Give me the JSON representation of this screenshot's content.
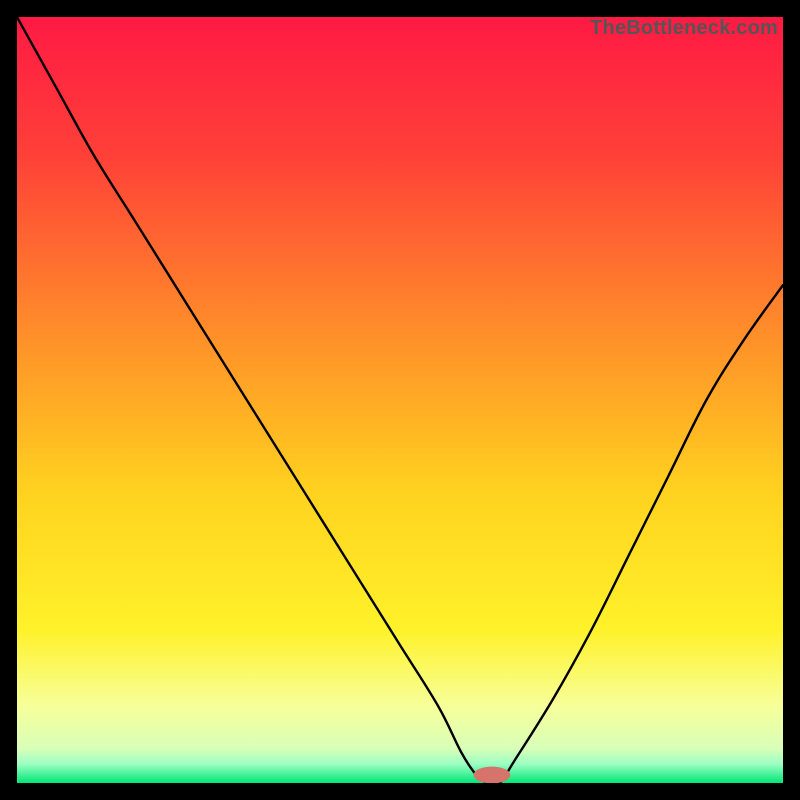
{
  "watermark": "TheBottleneck.com",
  "colors": {
    "frame_bg": "#000000",
    "curve_stroke": "#000000",
    "marker_fill": "#d6736b",
    "gradient_top": "#ff1a44",
    "gradient_mid1": "#ff8a2a",
    "gradient_mid2": "#ffe12a",
    "gradient_low": "#f7ff9a",
    "gradient_green_light": "#9dffc3",
    "gradient_green": "#00e676"
  },
  "chart_data": {
    "type": "line",
    "title": "",
    "xlabel": "",
    "ylabel": "",
    "xlim": [
      0,
      100
    ],
    "ylim": [
      0,
      100
    ],
    "series": [
      {
        "name": "bottleneck-curve",
        "x": [
          0,
          5,
          10,
          15,
          20,
          25,
          30,
          35,
          40,
          45,
          50,
          55,
          58,
          60,
          61.5,
          63,
          65,
          70,
          75,
          80,
          85,
          90,
          95,
          100
        ],
        "values": [
          100,
          91,
          82,
          74,
          66,
          58,
          50,
          42,
          34,
          26,
          18,
          10,
          4,
          1,
          0,
          0,
          3,
          11,
          20,
          30,
          40,
          50,
          58,
          65
        ]
      }
    ],
    "marker": {
      "x": 62,
      "y": 0,
      "rx": 2.4,
      "ry": 1.1
    },
    "background_gradient_stops": [
      {
        "offset": 0.0,
        "color": "#ff1a44"
      },
      {
        "offset": 0.18,
        "color": "#ff4038"
      },
      {
        "offset": 0.4,
        "color": "#ff8a2a"
      },
      {
        "offset": 0.62,
        "color": "#ffd21f"
      },
      {
        "offset": 0.8,
        "color": "#fff22a"
      },
      {
        "offset": 0.9,
        "color": "#f7ff9a"
      },
      {
        "offset": 0.955,
        "color": "#d8ffb8"
      },
      {
        "offset": 0.975,
        "color": "#9dffc3"
      },
      {
        "offset": 1.0,
        "color": "#00e676"
      }
    ]
  }
}
